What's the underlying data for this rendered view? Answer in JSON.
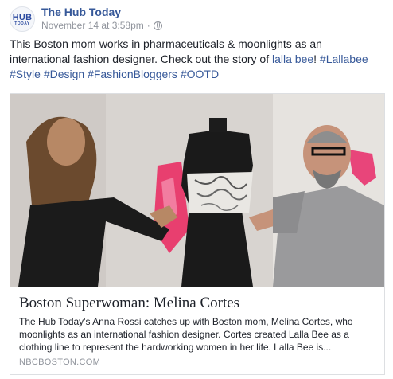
{
  "post": {
    "page_name": "The Hub Today",
    "avatar_line1": "HUB",
    "avatar_line2": "TODAY",
    "timestamp": "November 14 at 3:58pm",
    "separator": "·",
    "privacy_icon": "globe-icon",
    "text_main": "This Boston mom works in pharmaceuticals & moonlights as an international fashion designer. Check out the story of ",
    "mention": "lalla bee",
    "text_after_mention": "! ",
    "hashtags": [
      "#Lallabee",
      "#Style",
      "#Design",
      "#FashionBloggers",
      "#OOTD"
    ]
  },
  "link_preview": {
    "title": "Boston Superwoman: Melina Cortes",
    "description": "The Hub Today's Anna Rossi catches up with Boston mom, Melina Cortes, who moonlights as an international fashion designer. Cortes created Lalla Bee as a clothing line to represent the hardworking women in her life. Lalla Bee is...",
    "domain": "NBCBOSTON.COM"
  },
  "colors": {
    "link_blue": "#365899",
    "meta_gray": "#90949c",
    "text": "#1d2129"
  }
}
